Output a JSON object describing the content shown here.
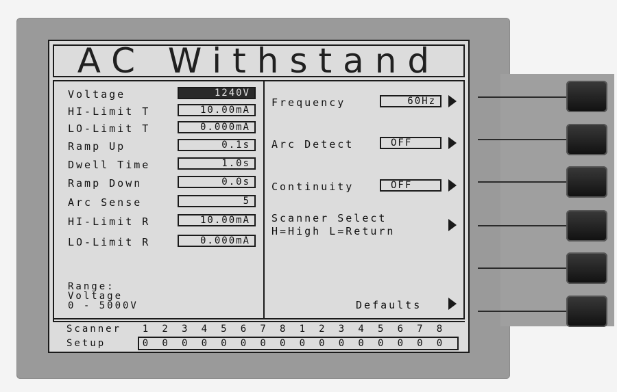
{
  "title": "AC Withstand",
  "left_params": [
    {
      "label": "Voltage",
      "value": "1240V",
      "selected": true
    },
    {
      "label": "HI-Limit T",
      "value": "10.00mA",
      "selected": false
    },
    {
      "label": "LO-Limit T",
      "value": "0.000mA",
      "selected": false
    },
    {
      "label": "Ramp Up",
      "value": "0.1s",
      "selected": false
    },
    {
      "label": "Dwell Time",
      "value": "1.0s",
      "selected": false
    },
    {
      "label": "Ramp Down",
      "value": "0.0s",
      "selected": false
    },
    {
      "label": "Arc Sense",
      "value": "5",
      "selected": false
    },
    {
      "label": "HI-Limit R",
      "value": "10.00mA",
      "selected": false
    },
    {
      "label": "LO-Limit R",
      "value": "0.000mA",
      "selected": false
    }
  ],
  "right_params": {
    "frequency": {
      "label": "Frequency",
      "value": "60Hz"
    },
    "arc_detect": {
      "label": "Arc Detect",
      "value": "OFF"
    },
    "continuity": {
      "label": "Continuity",
      "value": "OFF"
    },
    "scanner_select": {
      "line1": "Scanner Select",
      "line2": "H=High L=Return"
    },
    "defaults": {
      "label": "Defaults"
    }
  },
  "range": {
    "line1": "Range:",
    "line2": "Voltage",
    "line3": "0 - 5000V"
  },
  "scanner": {
    "label": "Scanner",
    "channels": [
      "1",
      "2",
      "3",
      "4",
      "5",
      "6",
      "7",
      "8",
      "1",
      "2",
      "3",
      "4",
      "5",
      "6",
      "7",
      "8"
    ],
    "setup_label": "Setup",
    "setup_values": [
      "0",
      "0",
      "0",
      "0",
      "0",
      "0",
      "0",
      "0",
      "0",
      "0",
      "0",
      "0",
      "0",
      "0",
      "0",
      "0"
    ]
  }
}
